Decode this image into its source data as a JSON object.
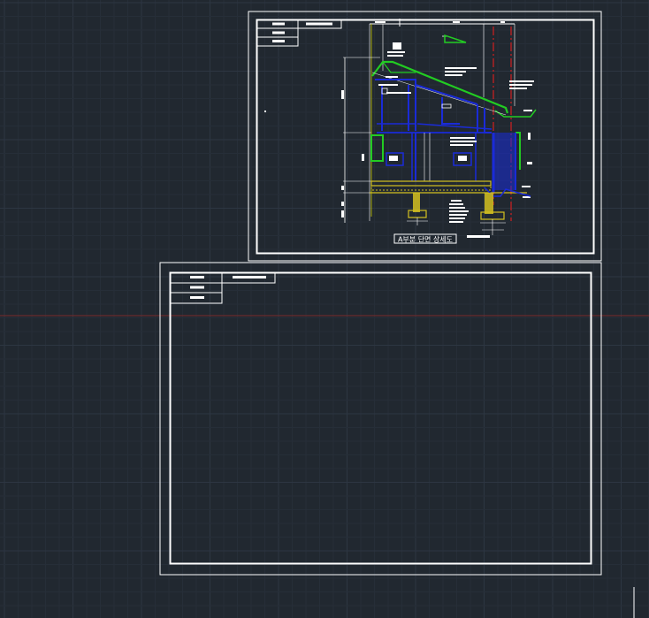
{
  "colors": {
    "background": "#212830",
    "grid_minor": "#262e38",
    "grid_major": "#2d3642",
    "frame": "#ffffff",
    "ucs_axis": "#7a2a2a",
    "wall_blue": "#1a2bd8",
    "roof_green": "#22cc22",
    "foundation_yellow": "#d4c020",
    "centerline_red": "#d02020",
    "guide_yellow": "#c8c800"
  },
  "sheets": [
    {
      "id": "sheet-top",
      "drawing_caption": "A부분 단면 상세도",
      "has_drawing": true
    },
    {
      "id": "sheet-bottom",
      "has_drawing": false
    }
  ],
  "cursor": {
    "icon": "crosshair-icon"
  }
}
